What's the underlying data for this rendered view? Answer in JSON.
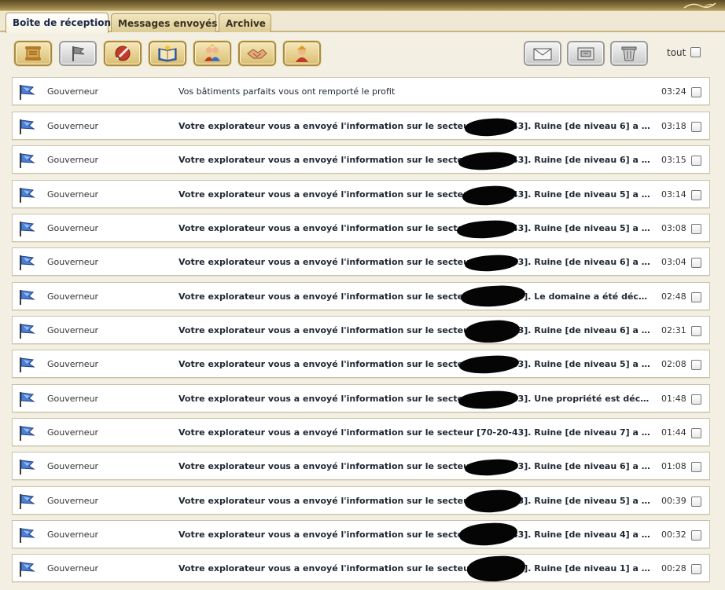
{
  "tabs": [
    {
      "label": "Boîte de réception",
      "active": true
    },
    {
      "label": "Messages envoyés",
      "active": false
    },
    {
      "label": "Archive",
      "active": false
    }
  ],
  "toolbar": {
    "left_icons": [
      "scroll-icon",
      "flag-icon",
      "sword-shield-icon",
      "book-icon",
      "people-icon",
      "handshake-icon",
      "warrior-icon"
    ],
    "right_icons": [
      "envelope-icon",
      "archive-box-icon",
      "trash-bin-icon"
    ],
    "select_all_label": "tout"
  },
  "colors": {
    "accent": "#b49b5a",
    "flag_blue": "#4a7fd6",
    "row_border": "#c9c2aa",
    "background": "#f3efe2"
  },
  "messages": [
    {
      "sender": "Gouverneur",
      "subject": "Vos bâtiments parfaits vous ont remporté le profit",
      "time": "03:24",
      "unread": false
    },
    {
      "sender": "Gouverneur",
      "subject": "Votre explorateur vous a envoyé l'information sur le secteur [70-20-43]. Ruine [de niveau 6] a été ...",
      "time": "03:18",
      "unread": true
    },
    {
      "sender": "Gouverneur",
      "subject": "Votre explorateur vous a envoyé l'information sur le secteur [70-20-43]. Ruine [de niveau 6] a été ...",
      "time": "03:15",
      "unread": true
    },
    {
      "sender": "Gouverneur",
      "subject": "Votre explorateur vous a envoyé l'information sur le secteur [70-20-43]. Ruine [de niveau 5] a été ...",
      "time": "03:14",
      "unread": true
    },
    {
      "sender": "Gouverneur",
      "subject": "Votre explorateur vous a envoyé l'information sur le secteur [70-20-43]. Ruine [de niveau 5] a été ...",
      "time": "03:08",
      "unread": true
    },
    {
      "sender": "Gouverneur",
      "subject": "Votre explorateur vous a envoyé l'information sur le secteur [70-20-43]. Ruine [de niveau 6] a été ...",
      "time": "03:04",
      "unread": true
    },
    {
      "sender": "Gouverneur",
      "subject": "Votre explorateur vous a envoyé l'information sur le secteur [70-20-43]. Le domaine a été décou...",
      "time": "02:48",
      "unread": true
    },
    {
      "sender": "Gouverneur",
      "subject": "Votre explorateur vous a envoyé l'information sur le secteur [70-20-43]. Ruine [de niveau 6] a été ...",
      "time": "02:31",
      "unread": true
    },
    {
      "sender": "Gouverneur",
      "subject": "Votre explorateur vous a envoyé l'information sur le secteur [70-20-43]. Ruine [de niveau 5] a été ...",
      "time": "02:08",
      "unread": true
    },
    {
      "sender": "Gouverneur",
      "subject": "Votre explorateur vous a envoyé l'information sur le secteur [70-20-43]. Une propriété est découv...",
      "time": "01:48",
      "unread": true
    },
    {
      "sender": "Gouverneur",
      "subject": "Votre explorateur vous a envoyé l'information sur le secteur [70-20-43]. Ruine [de niveau 7] a été ...",
      "time": "01:44",
      "unread": true
    },
    {
      "sender": "Gouverneur",
      "subject": "Votre explorateur vous a envoyé l'information sur le secteur [70-20-43]. Ruine [de niveau 6] a été ...",
      "time": "01:08",
      "unread": true
    },
    {
      "sender": "Gouverneur",
      "subject": "Votre explorateur vous a envoyé l'information sur le secteur [70-20-43]. Ruine [de niveau 5] a été ...",
      "time": "00:39",
      "unread": true
    },
    {
      "sender": "Gouverneur",
      "subject": "Votre explorateur vous a envoyé l'information sur le secteur [70-20-43]. Ruine [de niveau 4] a été ...",
      "time": "00:32",
      "unread": true
    },
    {
      "sender": "Gouverneur",
      "subject": "Votre explorateur vous a envoyé l'information sur le secteur [70-20-43]. Ruine [de niveau 1] a été ...",
      "time": "00:28",
      "unread": true
    }
  ]
}
